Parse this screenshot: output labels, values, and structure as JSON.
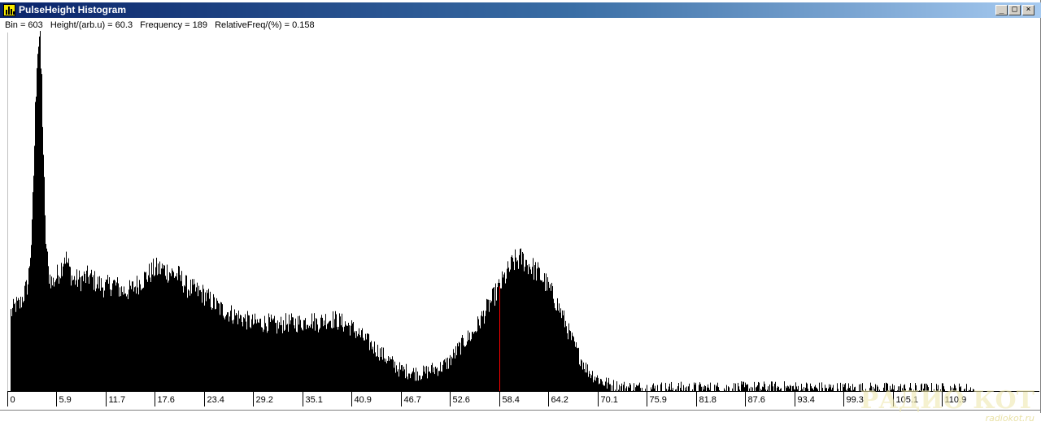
{
  "window": {
    "title": "PulseHeight Histogram",
    "icon": "histogram-icon",
    "controls": {
      "minimize": "_",
      "maximize": "□",
      "close": "×"
    }
  },
  "readout": {
    "bin": "Bin = 603",
    "height": "Height/(arb.u) = 60.3",
    "frequency": "Frequency = 189",
    "relfreq": "RelativeFreq/(%) = 0.158"
  },
  "watermark": {
    "logo": "РАДИО КОТ",
    "site": "radiokot.ru"
  },
  "colors": {
    "bars": "#000000",
    "cursor": "#ff0000",
    "titlebar": "#0a246a"
  },
  "chart_data": {
    "type": "bar",
    "title": "PulseHeight Histogram",
    "xlabel": "",
    "ylabel": "",
    "xlim": [
      0,
      118.5
    ],
    "ylim": [
      0,
      1
    ],
    "x_ticks": [
      "0",
      "5.9",
      "11.7",
      "17.6",
      "23.4",
      "29.2",
      "35.1",
      "40.9",
      "46.7",
      "52.6",
      "58.4",
      "64.2",
      "70.1",
      "75.9",
      "81.8",
      "87.6",
      "93.4",
      "99.3",
      "105.1",
      "110.9"
    ],
    "cursor_x": 60.3,
    "envelope": {
      "x": [
        0.5,
        1.0,
        1.5,
        2.5,
        3.0,
        3.3,
        3.6,
        3.9,
        4.2,
        4.6,
        5.0,
        5.5,
        6.0,
        6.5,
        7.0,
        8.0,
        9.0,
        10.0,
        11.0,
        12.0,
        13.0,
        14.0,
        15.0,
        16.0,
        17.0,
        18.0,
        19.0,
        20.0,
        21.0,
        22.0,
        23.0,
        24.0,
        25.0,
        26.0,
        27.0,
        28.0,
        29.0,
        30.0,
        31.0,
        32.0,
        33.0,
        34.0,
        35.0,
        36.0,
        37.0,
        38.0,
        39.0,
        40.0,
        41.0,
        42.0,
        43.0,
        44.0,
        45.0,
        46.0,
        47.0,
        48.0,
        49.0,
        50.0,
        51.0,
        52.0,
        53.0,
        54.0,
        55.0,
        56.0,
        57.0,
        58.0,
        59.0,
        60.0,
        61.0,
        62.0,
        63.0,
        64.0,
        65.0,
        66.0,
        67.0,
        68.0,
        69.0,
        70.0,
        71.0,
        72.0,
        73.0,
        74.0,
        75.0,
        77.0,
        80.0,
        85.0,
        90.0,
        95.0,
        100.0,
        105.0,
        110.0,
        113.0,
        116.0,
        118.5
      ],
      "y": [
        0.22,
        0.24,
        0.24,
        0.3,
        0.45,
        0.7,
        0.95,
        0.99,
        0.85,
        0.45,
        0.33,
        0.3,
        0.32,
        0.34,
        0.38,
        0.31,
        0.31,
        0.32,
        0.3,
        0.29,
        0.3,
        0.28,
        0.28,
        0.3,
        0.32,
        0.34,
        0.34,
        0.33,
        0.32,
        0.29,
        0.28,
        0.27,
        0.25,
        0.23,
        0.22,
        0.21,
        0.2,
        0.19,
        0.19,
        0.19,
        0.18,
        0.19,
        0.19,
        0.19,
        0.2,
        0.19,
        0.2,
        0.2,
        0.19,
        0.18,
        0.16,
        0.14,
        0.12,
        0.1,
        0.08,
        0.06,
        0.055,
        0.05,
        0.05,
        0.06,
        0.065,
        0.08,
        0.11,
        0.14,
        0.16,
        0.2,
        0.24,
        0.28,
        0.32,
        0.36,
        0.37,
        0.35,
        0.33,
        0.3,
        0.26,
        0.21,
        0.15,
        0.1,
        0.06,
        0.04,
        0.025,
        0.015,
        0.01,
        0.008,
        0.007,
        0.006,
        0.007,
        0.008,
        0.006,
        0.005,
        0.004,
        0.004,
        0.003,
        0.003
      ]
    }
  }
}
